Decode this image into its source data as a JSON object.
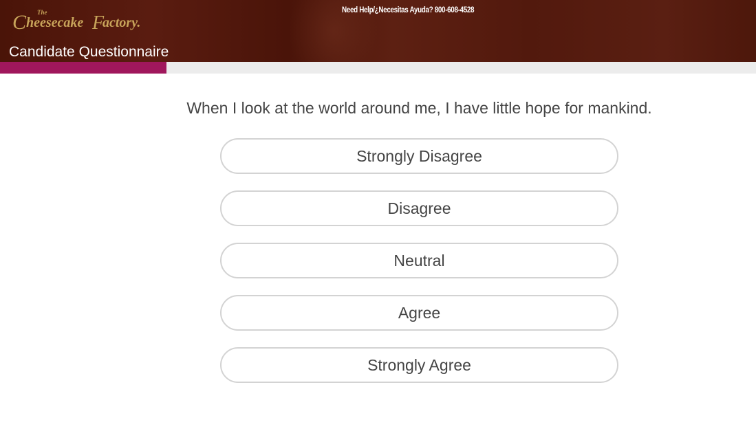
{
  "header": {
    "logo_text": "The Cheesecake Factory",
    "help_text": "Need Help/¿Necesitas Ayuda? 800-608-4528",
    "page_title": "Candidate Questionnaire"
  },
  "progress": {
    "fraction": 0.22,
    "fill_color": "#a0175c",
    "track_color": "#ececec"
  },
  "question": {
    "text": "When I look at the world around me, I have little hope for mankind."
  },
  "options": [
    {
      "label": "Strongly Disagree"
    },
    {
      "label": "Disagree"
    },
    {
      "label": "Neutral"
    },
    {
      "label": "Agree"
    },
    {
      "label": "Strongly Agree"
    }
  ],
  "colors": {
    "header_bg": "#4f1709",
    "logo_gold": "#c8a45a",
    "text": "#444444",
    "button_border": "#d3d3d3"
  }
}
